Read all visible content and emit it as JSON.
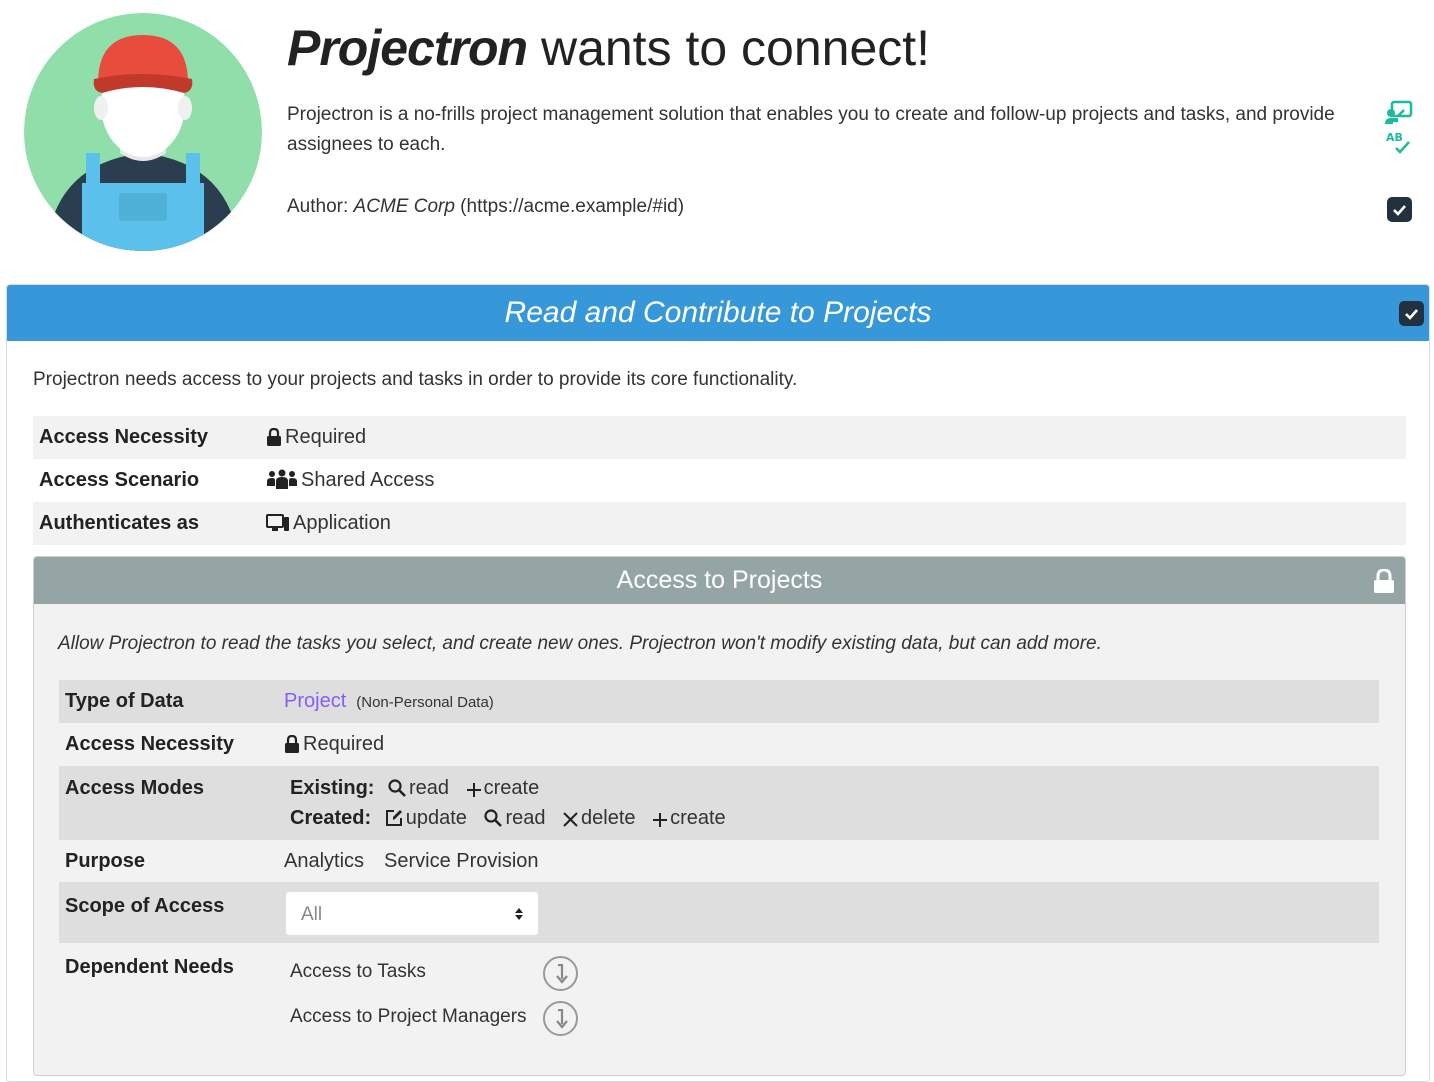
{
  "header": {
    "app_name": "Projectron",
    "title_suffix": " wants to connect!",
    "description": "Projectron is a no-frills project management solution that enables you to create and follow-up projects and tasks, and provide assignees to each.",
    "author_prefix": "Author: ",
    "author_name": "ACME Corp",
    "author_url": " (https://acme.example/#id)",
    "icons": [
      "presentation-icon",
      "spellcheck-icon"
    ],
    "author_checked": true
  },
  "section": {
    "title": "Read and Contribute to Projects",
    "checked": true,
    "description": "Projectron needs access to your projects and tasks in order to provide its core functionality.",
    "rows": [
      {
        "label": "Access Necessity",
        "value": "Required",
        "icon": "lock-icon"
      },
      {
        "label": "Access Scenario",
        "value": "Shared Access",
        "icon": "users-icon"
      },
      {
        "label": "Authenticates as",
        "value": "Application",
        "icon": "desktop-mobile-icon"
      }
    ]
  },
  "access": {
    "title": "Access to Projects",
    "description": "Allow Projectron to read the tasks you select, and create new ones. Projectron won't modify existing data, but can add more.",
    "type_label": "Type of Data",
    "type_value": "Project",
    "type_note": "(Non-Personal Data)",
    "necessity_label": "Access Necessity",
    "necessity_value": "Required",
    "modes_label": "Access Modes",
    "existing_label": "Existing:",
    "existing_modes": [
      "read",
      "create"
    ],
    "created_label": "Created:",
    "created_modes": [
      "update",
      "read",
      "delete",
      "create"
    ],
    "purpose_label": "Purpose",
    "purposes": [
      "Analytics",
      "Service Provision"
    ],
    "scope_label": "Scope of Access",
    "scope_value": "All",
    "dependent_label": "Dependent Needs",
    "dependents": [
      "Access to Tasks",
      "Access to Project Managers"
    ]
  },
  "colors": {
    "section_bar": "#3697d9",
    "panel_bar": "#95a5a6",
    "project_link": "#8a5cf5",
    "teal_icons": "#1abc9c",
    "checkbox": "#22313f"
  }
}
